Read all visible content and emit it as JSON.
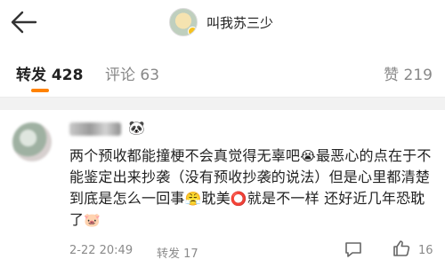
{
  "header": {
    "title": "叫我苏三少",
    "icons": {
      "back": "back-arrow-icon",
      "avatar": "avatar"
    }
  },
  "tabs": [
    {
      "label": "转发",
      "count": "428",
      "active": true
    },
    {
      "label": "评论",
      "count": "63",
      "active": false
    },
    {
      "label": "赞",
      "count": "219",
      "active": false
    }
  ],
  "comment": {
    "text_parts": {
      "p1": "两个预收都能撞梗不会真觉得无辜吧",
      "e1": "😭",
      "p2": "最恶心的点在于不能鉴定出来抄袭（没有预收抄袭的说法）但是心里都清楚到底是怎么一回事",
      "e2": "😤",
      "p3": "耽美",
      "e3": "⭕",
      "p4": "就是不一样 还好近几年恐耽了",
      "e4": "🐷"
    },
    "name_badge_icon": "🐼",
    "time": "2-22 20:49",
    "repost_label": "转发 17",
    "like_count": "16"
  },
  "colors": {
    "accent": "#ff8200",
    "muted": "#8a8a8a",
    "background": "#f2f2f2"
  }
}
